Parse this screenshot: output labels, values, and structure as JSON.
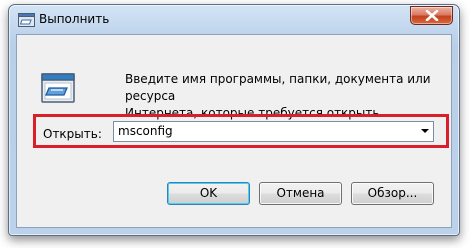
{
  "window": {
    "title": "Выполнить",
    "title_icon": "run-icon",
    "close_icon": "close-icon"
  },
  "description": {
    "line1": "Введите имя программы, папки, документа или ресурса",
    "line2": "Интернета, которые требуется открыть."
  },
  "open_field": {
    "label": "Открыть:",
    "value": "msconfig",
    "dropdown_icon": "chevron-down-icon"
  },
  "buttons": {
    "ok": "OK",
    "cancel": "Отмена",
    "browse": "Обзор..."
  },
  "colors": {
    "highlight": "#d9202a",
    "close_button": "#c3411f",
    "client_background": "#f0f0f0"
  }
}
